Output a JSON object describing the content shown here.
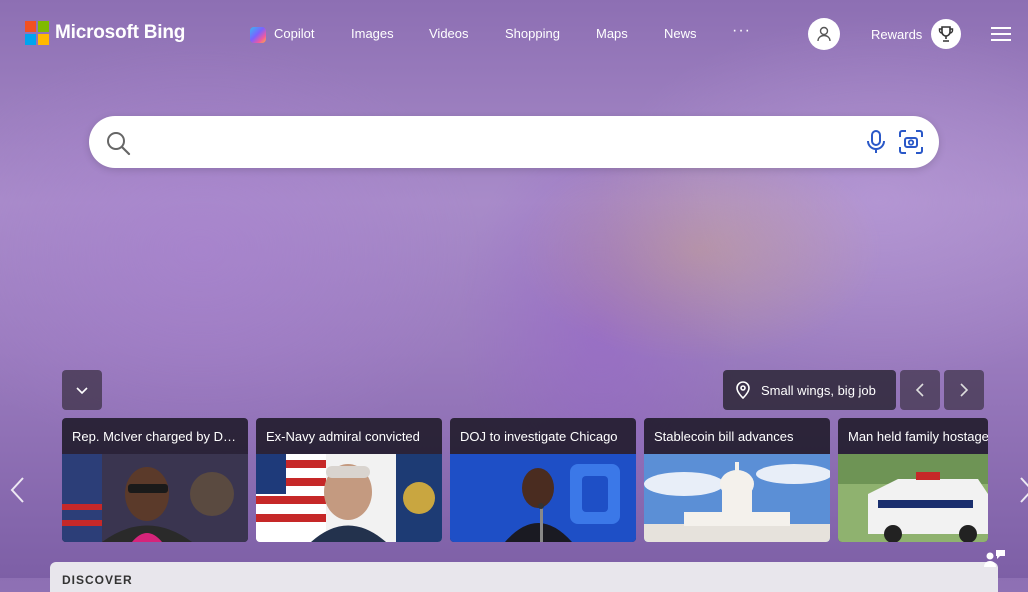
{
  "brand": {
    "name": "Microsoft Bing",
    "colors": {
      "red": "#f25022",
      "green": "#7fba00",
      "blue": "#00a4ef",
      "yellow": "#ffb900"
    }
  },
  "nav": {
    "items": [
      {
        "label": "Copilot",
        "icon": "copilot-icon"
      },
      {
        "label": "Images"
      },
      {
        "label": "Videos"
      },
      {
        "label": "Shopping"
      },
      {
        "label": "Maps"
      },
      {
        "label": "News"
      }
    ],
    "more": "···"
  },
  "header": {
    "rewards_label": "Rewards",
    "user_icon": "user-icon",
    "rewards_icon": "trophy-icon",
    "menu_icon": "hamburger-menu-icon"
  },
  "search": {
    "value": "",
    "placeholder": "",
    "icons": [
      "search-icon",
      "microphone-icon",
      "visual-search-icon"
    ]
  },
  "image_info": {
    "caption": "Small wings, big job"
  },
  "news_cards": [
    {
      "title": "Rep. McIver charged by D…"
    },
    {
      "title": "Ex-Navy admiral convicted"
    },
    {
      "title": "DOJ to investigate Chicago"
    },
    {
      "title": "Stablecoin bill advances"
    },
    {
      "title": "Man held family hostage"
    }
  ],
  "bottom": {
    "label": "DISCOVER"
  }
}
